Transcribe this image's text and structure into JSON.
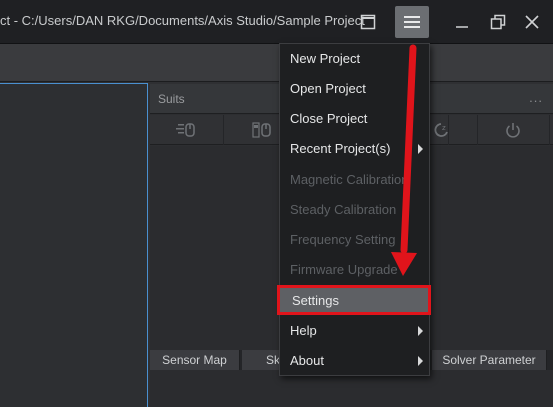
{
  "window": {
    "title": "ct - C:/Users/DAN RKG/Documents/Axis Studio/Sample Project"
  },
  "titlebar_buttons": [
    {
      "name": "window-mode",
      "icon": "window-icon"
    },
    {
      "name": "main-menu",
      "icon": "hamburger-menu-icon"
    },
    {
      "name": "minimize",
      "icon": "minimize-icon"
    },
    {
      "name": "maximize",
      "icon": "restore-icon"
    },
    {
      "name": "close",
      "icon": "close-icon"
    }
  ],
  "suits_panel": {
    "title": "Suits",
    "more": "...",
    "tools": [
      {
        "icon": "sensor-list-icon"
      },
      {
        "icon": "sensor-calibrate-icon"
      },
      {
        "icon": "hidden-tool-1"
      },
      {
        "icon": "hidden-tool-2"
      },
      {
        "icon": "zz-sleep-icon"
      },
      {
        "icon": "power-icon"
      }
    ]
  },
  "bottom_tabs": {
    "sensor_map": "Sensor Map",
    "sk": "Sk",
    "solver_parameter": "Solver Parameter"
  },
  "menu": {
    "items": [
      {
        "label": "New Project",
        "enabled": true,
        "submenu": false
      },
      {
        "label": "Open Project",
        "enabled": true,
        "submenu": false
      },
      {
        "label": "Close Project",
        "enabled": true,
        "submenu": false
      },
      {
        "label": "Recent Project(s)",
        "enabled": true,
        "submenu": true
      },
      {
        "label": "Magnetic Calibration",
        "enabled": false,
        "submenu": false
      },
      {
        "label": "Steady Calibration",
        "enabled": false,
        "submenu": false
      },
      {
        "label": "Frequency Setting",
        "enabled": false,
        "submenu": false
      },
      {
        "label": "Firmware Upgrade",
        "enabled": false,
        "submenu": false
      },
      {
        "label": "Settings",
        "enabled": true,
        "submenu": false,
        "highlighted": true
      },
      {
        "label": "Help",
        "enabled": true,
        "submenu": true
      },
      {
        "label": "About",
        "enabled": true,
        "submenu": true
      }
    ]
  },
  "colors": {
    "highlight_box": "#e0141b",
    "annotation_arrow": "#e0141b",
    "viewport_border": "#4a90d0"
  }
}
